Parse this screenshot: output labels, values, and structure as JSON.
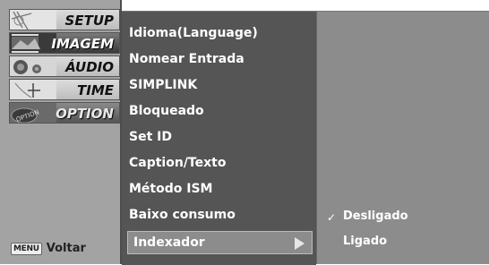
{
  "sidebar": {
    "tabs": [
      {
        "label": "SETUP",
        "icon": "setup-thumbnail-icon"
      },
      {
        "label": "IMAGEM",
        "icon": "image-thumbnail-icon"
      },
      {
        "label": "ÁUDIO",
        "icon": "audio-thumbnail-icon"
      },
      {
        "label": "TIME",
        "icon": "time-thumbnail-icon"
      },
      {
        "label": "OPTION",
        "icon": "option-thumbnail-icon"
      }
    ],
    "menu_key": "MENU",
    "back_label": "Voltar"
  },
  "menu": {
    "items": [
      "Idioma(Language)",
      "Nomear Entrada",
      "SIMPLINK",
      "Bloqueado",
      "Set ID",
      "Caption/Texto",
      "Método ISM",
      "Baixo consumo",
      "Indexador"
    ],
    "selected_index": 8
  },
  "options": {
    "items": [
      "Desligado",
      "Ligado"
    ],
    "checked": "Desligado",
    "check_glyph": "✓"
  },
  "colors": {
    "sidebar_bg": "#a3a3a3",
    "menu_bg": "#555555",
    "options_bg": "#8c8c8c",
    "highlight_bg": "#8c8c8c",
    "text": "#ffffff"
  }
}
